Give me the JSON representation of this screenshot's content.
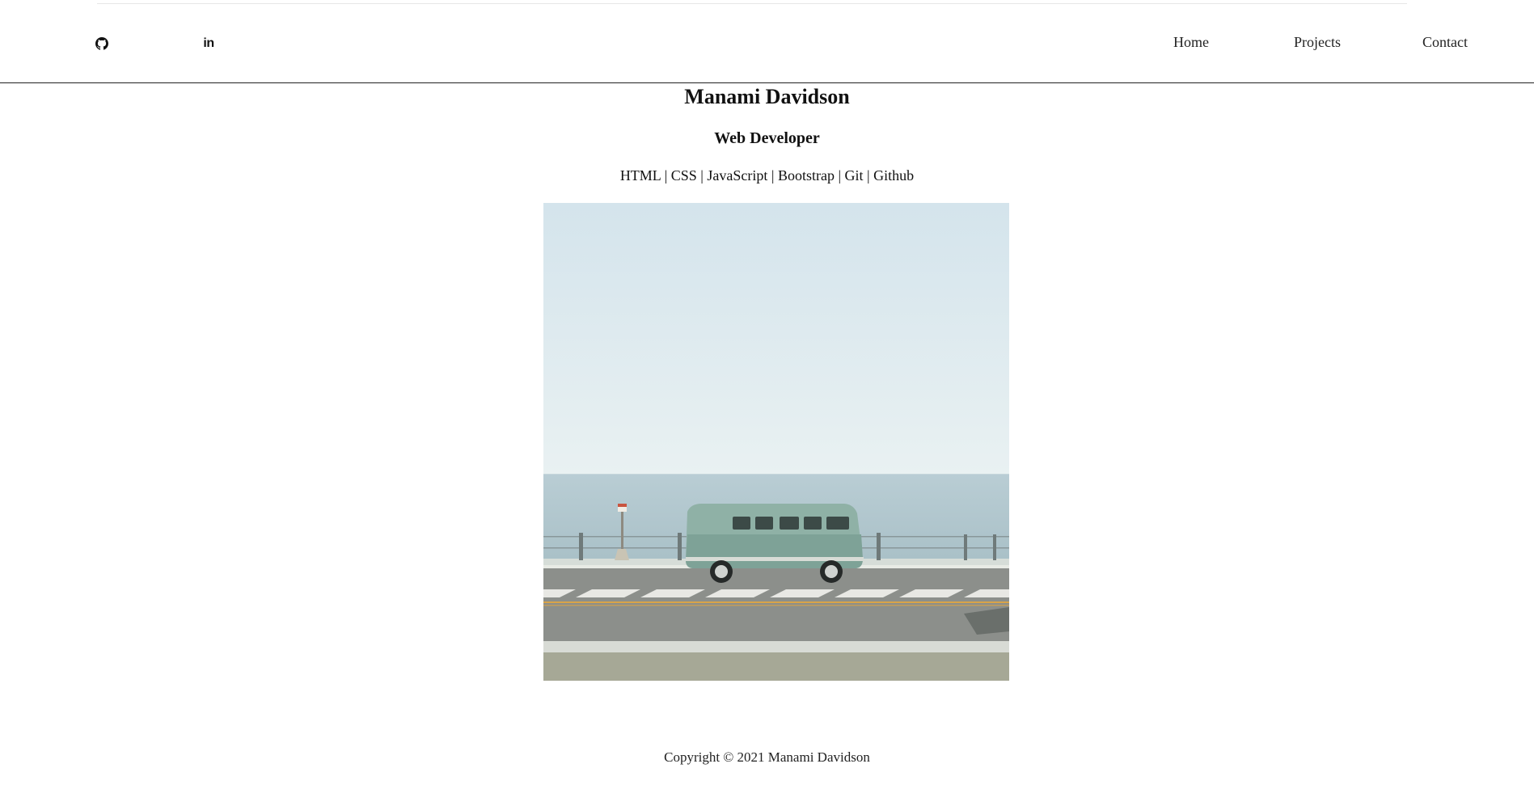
{
  "header": {
    "social": [
      {
        "icon": "github-icon"
      },
      {
        "icon": "linkedin-icon",
        "glyph": "in"
      }
    ],
    "nav": [
      {
        "label": "Home"
      },
      {
        "label": "Projects"
      },
      {
        "label": "Contact"
      }
    ]
  },
  "hero": {
    "name": "Manami Davidson",
    "role": "Web Developer",
    "skills": "HTML | CSS | JavaScript | Bootstrap | Git | Github"
  },
  "footer": {
    "copyright": "Copyright © 2021 Manami Davidson"
  }
}
